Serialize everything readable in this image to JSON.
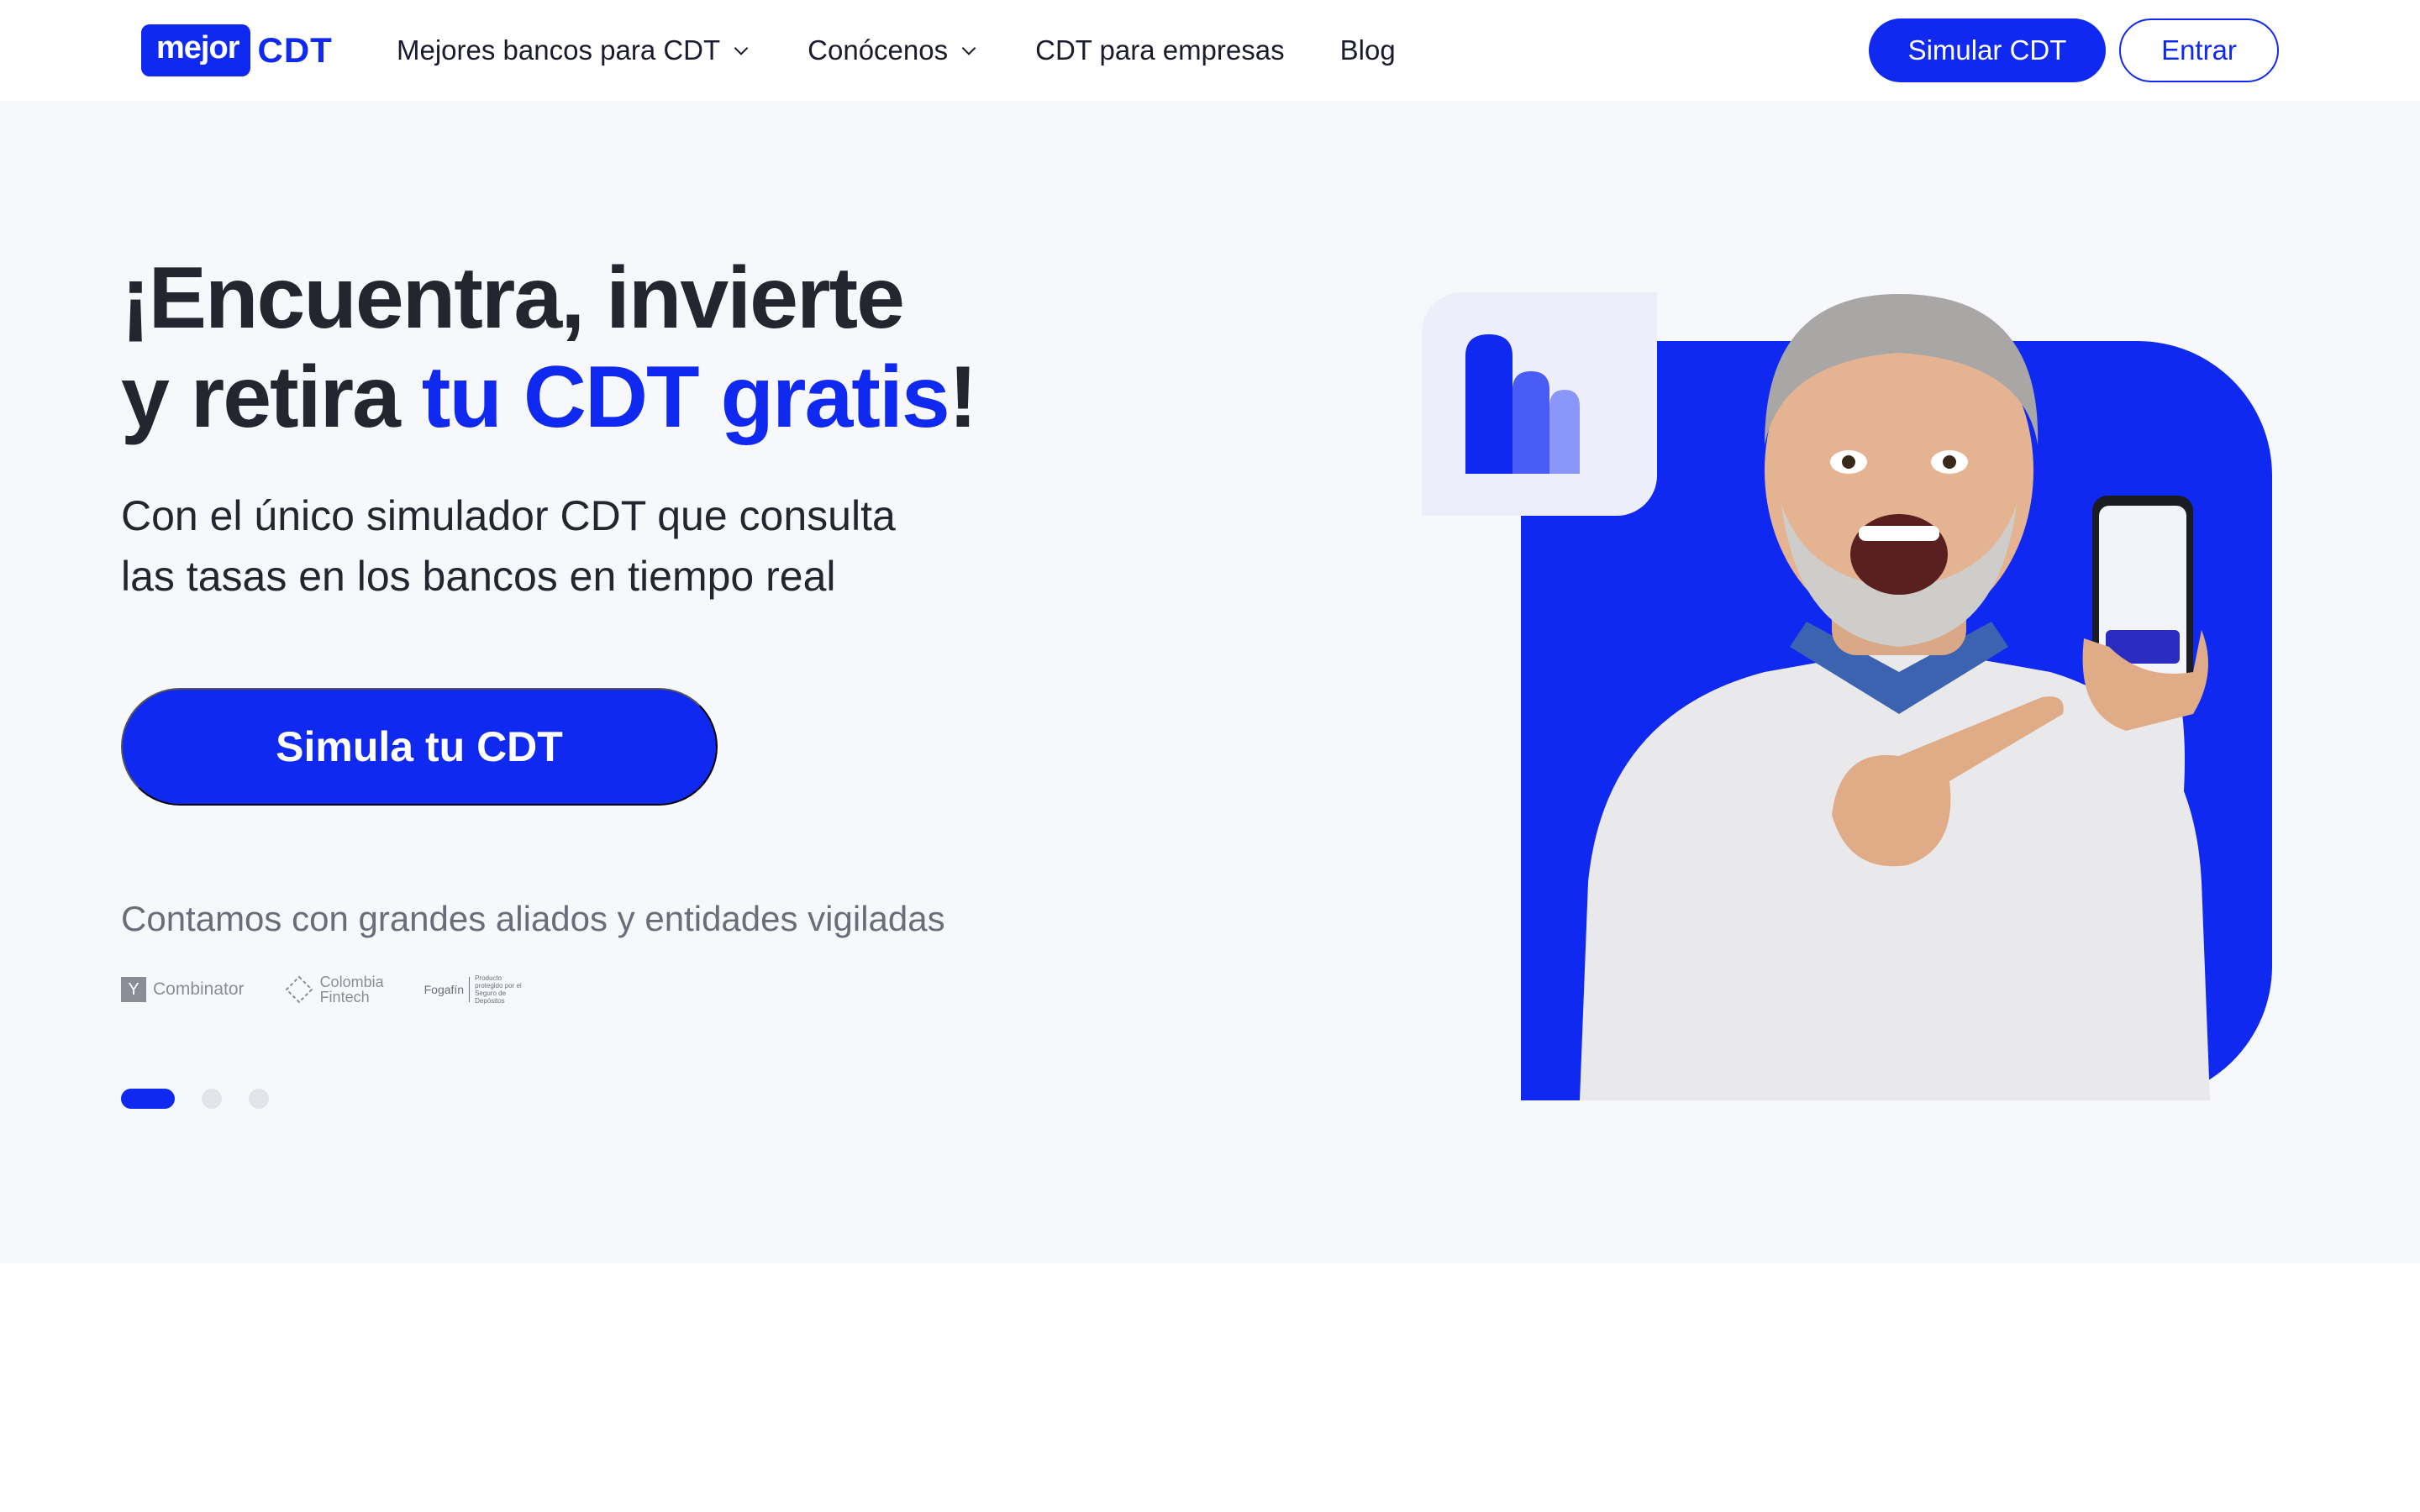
{
  "header": {
    "logo": {
      "part1": "mejor",
      "part2": "CDT"
    },
    "nav": [
      {
        "label": "Mejores bancos para CDT",
        "has_dropdown": true
      },
      {
        "label": "Conócenos",
        "has_dropdown": true
      },
      {
        "label": "CDT para empresas",
        "has_dropdown": false
      },
      {
        "label": "Blog",
        "has_dropdown": false
      }
    ],
    "simular_label": "Simular CDT",
    "entrar_label": "Entrar"
  },
  "hero": {
    "title_line1": "¡Encuentra, invierte",
    "title_line2_prefix": "y retira ",
    "title_line2_accent": "tu CDT gratis",
    "title_line2_suffix": "!",
    "subtitle_line1": "Con el único simulador CDT que consulta",
    "subtitle_line2": "las tasas en los bancos en tiempo real",
    "cta_label": "Simula tu CDT",
    "partners_text": "Contamos con grandes aliados y entidades vigiladas",
    "partners": {
      "yc_letter": "Y",
      "yc_name": "Combinator",
      "cf_line1": "Colombia",
      "cf_line2": "Fintech",
      "fog_name": "Fogafín",
      "fog_note": "Producto protegido por el Seguro de Depósitos"
    },
    "carousel": {
      "slides": 3,
      "active": 1
    }
  },
  "colors": {
    "accent": "#1029f0",
    "hero_bg": "#f7f8fc",
    "text": "#24262f"
  }
}
